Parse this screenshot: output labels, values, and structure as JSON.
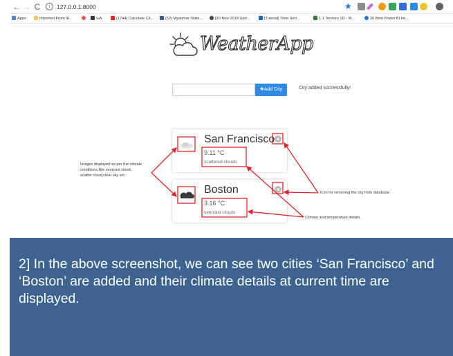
{
  "browser": {
    "back_icon": "←",
    "forward_icon": "→",
    "reload_icon": "C",
    "info_icon": "i",
    "url": "127.0.0.1:8000",
    "star_icon": "★"
  },
  "bookmarks": [
    {
      "label": "Apps",
      "color": "#4a86c8"
    },
    {
      "label": "Imported From IE",
      "color": "#f2c94c"
    },
    {
      "label": "",
      "color": "#e5534b"
    },
    {
      "label": "\\uA",
      "color": "#333333"
    },
    {
      "label": "(1744) Calculate Cli...",
      "color": "#e62117"
    },
    {
      "label": "(53) Myanmar State...",
      "color": "#3b5998"
    },
    {
      "label": "[20-Nov-2018 Upd...",
      "color": "#444444"
    },
    {
      "label": "[Tutorial] Time Seri...",
      "color": "#1565c0"
    },
    {
      "label": "1.1 Tensors 1D - I8...",
      "color": "#2e7d32"
    },
    {
      "label": "20 Best Power BI Int...",
      "color": "#1976d2"
    }
  ],
  "app": {
    "logo_text": "WeatherApp",
    "add_button": "✚Add City",
    "status_message": "City added successfully!"
  },
  "cities": [
    {
      "name": "San Francisco",
      "temperature": "9.11 °C",
      "description": "scattered clouds"
    },
    {
      "name": "Boston",
      "temperature": "3.16 °C",
      "description": "overcast clouds"
    }
  ],
  "annotations": {
    "images": [
      "Images displayed as per the climate",
      "conditions like overcast cloud,",
      "scatter cloud,clear sky etc."
    ],
    "remove_icon": "Icon for removing the city from database.",
    "climate": "Climate and temperature details."
  },
  "caption": "2] In the above screenshot, we can see two cities ‘San Francisco’ and ‘Boston’ are added and their climate details at current time are displayed.",
  "colors": {
    "accent": "#2e8ae6",
    "annotation": "#e0242a",
    "caption_bg": "#3d6491"
  }
}
